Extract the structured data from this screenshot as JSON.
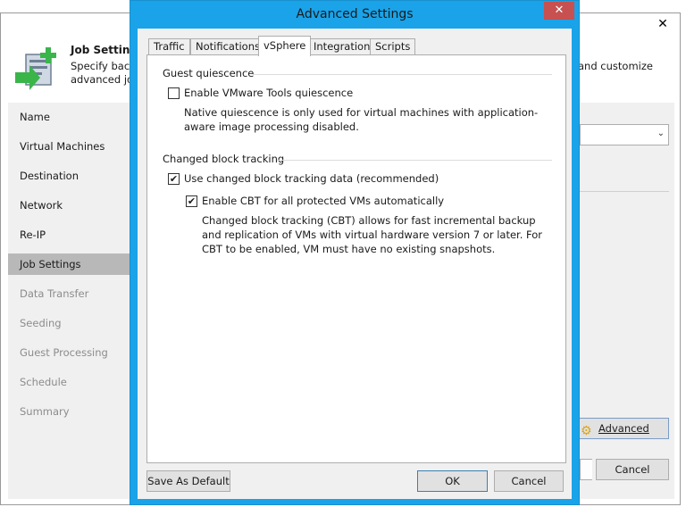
{
  "wizard": {
    "close_glyph": "✕",
    "header": {
      "title": "Job Settings",
      "desc": "Specify back advanced job",
      "desc_right": "and customize",
      "icon": "job-settings-icon"
    },
    "nav": [
      {
        "label": "Name",
        "state": "normal"
      },
      {
        "label": "Virtual Machines",
        "state": "normal"
      },
      {
        "label": "Destination",
        "state": "normal"
      },
      {
        "label": "Network",
        "state": "normal"
      },
      {
        "label": "Re-IP",
        "state": "normal"
      },
      {
        "label": "Job Settings",
        "state": "active"
      },
      {
        "label": "Data Transfer",
        "state": "disabled"
      },
      {
        "label": "Seeding",
        "state": "disabled"
      },
      {
        "label": "Guest Processing",
        "state": "disabled"
      },
      {
        "label": "Schedule",
        "state": "disabled"
      },
      {
        "label": "Summary",
        "state": "disabled"
      }
    ],
    "advanced_button": "Advanced",
    "cancel_button": "Cancel"
  },
  "dialog": {
    "title": "Advanced Settings",
    "close_glyph": "✕",
    "tabs": [
      "Traffic",
      "Notifications",
      "vSphere",
      "Integration",
      "Scripts"
    ],
    "active_tab": "vSphere",
    "guest_quiescence": {
      "label": "Guest quiescence",
      "checkbox_label": "Enable VMware Tools quiescence",
      "checked": false,
      "description": "Native quiescence is only used for virtual machines with application-aware image processing disabled."
    },
    "cbt": {
      "label": "Changed block tracking",
      "use_cbt_label": "Use changed block tracking data (recommended)",
      "use_cbt_checked": true,
      "enable_cbt_label": "Enable CBT for all protected VMs automatically",
      "enable_cbt_checked": true,
      "description": "Changed block tracking (CBT) allows for fast incremental backup and replication of VMs with virtual hardware version 7 or later. For CBT to be enabled, VM must have no existing snapshots."
    },
    "buttons": {
      "save_default": "Save As Default",
      "ok": "OK",
      "cancel": "Cancel"
    }
  },
  "colors": {
    "dialog_frame": "#1aa3e8",
    "close_button": "#c75050",
    "active_nav": "#b8b8b8"
  }
}
